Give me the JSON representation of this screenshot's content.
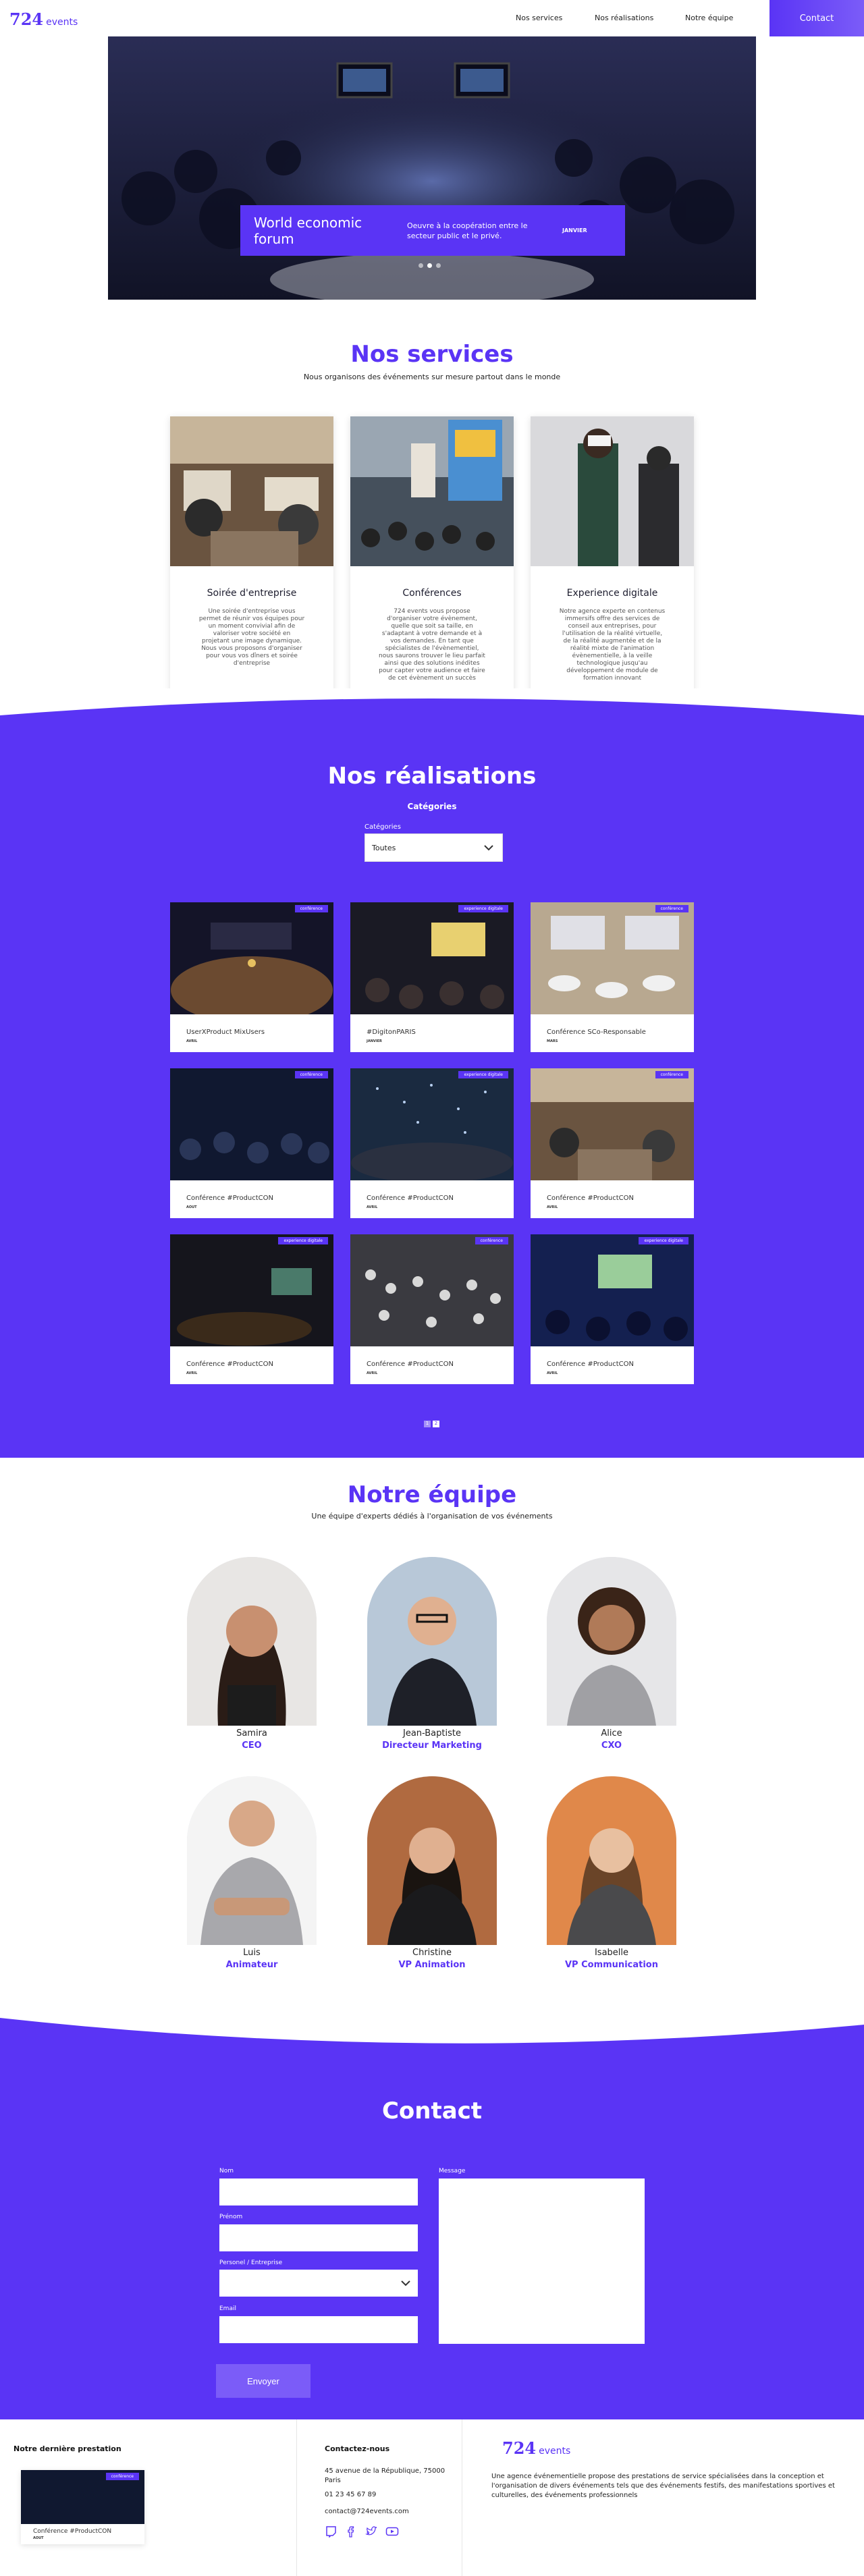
{
  "nav": {
    "logo_number": "724",
    "logo_word": "events",
    "links": [
      "Nos services",
      "Nos réalisations",
      "Notre équipe"
    ],
    "cta": "Contact"
  },
  "hero": {
    "title": "World economic forum",
    "description": "Oeuvre à la coopération entre le secteur public et le privé.",
    "date": "JANVIER",
    "slides": 3,
    "active_slide": 1
  },
  "services": {
    "title": "Nos services",
    "subtitle": "Nous organisons des événements sur mesure partout dans le monde",
    "cards": [
      {
        "title": "Soirée d'entreprise",
        "text": "Une soirée d'entreprise vous permet de réunir vos équipes pour un moment convivial afin de valoriser votre société en projetant une image dynamique. Nous vous proposons d'organiser pour vous vos dîners et soirée d'entreprise"
      },
      {
        "title": "Conférences",
        "text": "724 events vous propose d'organiser votre évènement, quelle que soit sa taille, en s'adaptant à votre demande et à vos demandes. En tant que spécialistes de l'évènementiel, nous saurons trouver le lieu parfait ainsi que des solutions inédites pour capter votre audience et faire de cet évènement un succès"
      },
      {
        "title": "Experience digitale",
        "text": "Notre agence experte en contenus immersifs offre des services de conseil aux entreprises, pour l'utilisation de la réalité virtuelle, de la réalité augmentée et de la réalité mixte de l'animation évènementielle, à la veille technologique jusqu'au développement de module de formation innovant"
      }
    ]
  },
  "realisations": {
    "title": "Nos réalisations",
    "categories_label": "Catégories",
    "select_label": "Catégories",
    "select_value": "Toutes",
    "items": [
      {
        "title": "UserXProduct MixUsers",
        "date": "AVRIL",
        "tag": "conférence"
      },
      {
        "title": "#DigitonPARIS",
        "date": "JANVIER",
        "tag": "experience digitale"
      },
      {
        "title": "Conférence SCo-Responsable",
        "date": "MARS",
        "tag": "conférence"
      },
      {
        "title": "Conférence #ProductCON",
        "date": "AOUT",
        "tag": "conférence"
      },
      {
        "title": "Conférence #ProductCON",
        "date": "AVRIL",
        "tag": "experience digitale"
      },
      {
        "title": "Conférence #ProductCON",
        "date": "AVRIL",
        "tag": "conférence"
      },
      {
        "title": "Conférence #ProductCON",
        "date": "AVRIL",
        "tag": "experience digitale"
      },
      {
        "title": "Conférence #ProductCON",
        "date": "AVRIL",
        "tag": "conférence"
      },
      {
        "title": "Conférence #ProductCON",
        "date": "AVRIL",
        "tag": "experience digitale"
      }
    ],
    "pages": [
      "1",
      "2"
    ],
    "active_page": 2
  },
  "team": {
    "title": "Notre équipe",
    "subtitle": "Une équipe d'experts dédiés à l'organisation de vos événements",
    "members": [
      {
        "name": "Samira",
        "role": "CEO"
      },
      {
        "name": "Jean-Baptiste",
        "role": "Directeur Marketing"
      },
      {
        "name": "Alice",
        "role": "CXO"
      },
      {
        "name": "Luis",
        "role": "Animateur"
      },
      {
        "name": "Christine",
        "role": "VP Animation"
      },
      {
        "name": "Isabelle",
        "role": "VP Communication"
      }
    ]
  },
  "contact": {
    "title": "Contact",
    "labels": {
      "nom": "Nom",
      "prenom": "Prénom",
      "type": "Personel / Entreprise",
      "email": "Email",
      "message": "Message"
    },
    "submit": "Envoyer"
  },
  "footer": {
    "last_title": "Notre dernière prestation",
    "last_item": {
      "title": "Conférence #ProductCON",
      "date": "AOUT",
      "tag": "conférence"
    },
    "contact_title": "Contactez-nous",
    "address_1": "45 avenue de la République, 75000",
    "address_2": "Paris",
    "phone": "01 23 45 67 89",
    "email": "contact@724events.com",
    "about": "Une agence événementielle propose des prestations de service spécialisées dans la conception et l'organisation de divers événements tels que des événements festifs, des manifestations sportives et culturelles, des événements professionnels"
  },
  "colors": {
    "violet": "#5a34f5"
  }
}
